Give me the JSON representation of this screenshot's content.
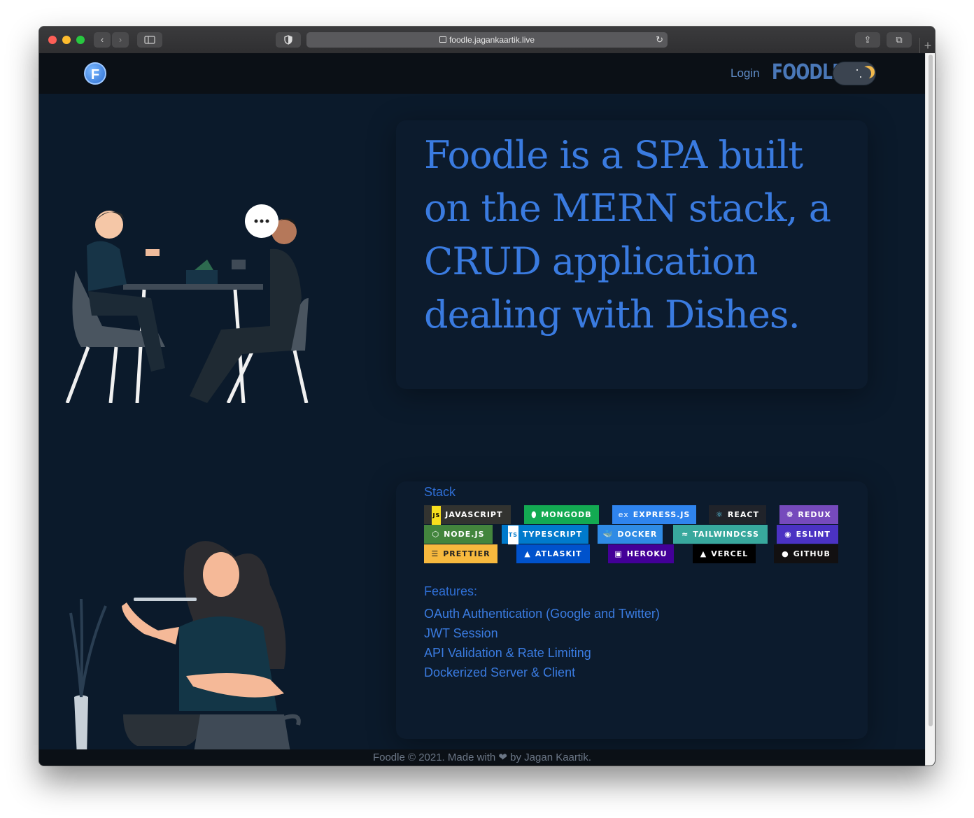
{
  "browser": {
    "url": "foodle.jagankaartik.live"
  },
  "nav": {
    "login": "Login",
    "brand": "FOODLE",
    "logo_letter": "F"
  },
  "hero": {
    "text": "Foodle is a SPA built on the MERN stack, a CRUD application dealing with Dishes."
  },
  "stack": {
    "title": "Stack",
    "badges": [
      {
        "label": "JAVASCRIPT",
        "icon": "js-icon",
        "color": "#323330"
      },
      {
        "label": "MONGODB",
        "icon": "leaf-icon",
        "color": "#13aa52"
      },
      {
        "label": "EXPRESS.JS",
        "icon": "express-icon",
        "color": "#2f84ee"
      },
      {
        "label": "REACT",
        "icon": "atom-icon",
        "color": "#20232a"
      },
      {
        "label": "REDUX",
        "icon": "redux-icon",
        "color": "#764abc"
      },
      {
        "label": "NODE.JS",
        "icon": "hexagon-icon",
        "color": "#43853d"
      },
      {
        "label": "TYPESCRIPT",
        "icon": "ts-icon",
        "color": "#007acc"
      },
      {
        "label": "DOCKER",
        "icon": "whale-icon",
        "color": "#2f8be5"
      },
      {
        "label": "TAILWINDCSS",
        "icon": "wave-icon",
        "color": "#38a89d"
      },
      {
        "label": "ESLINT",
        "icon": "eslint-icon",
        "color": "#4b32c3"
      },
      {
        "label": "PRETTIER",
        "icon": "prettier-icon",
        "color": "#f7b93e"
      },
      {
        "label": "ATLASKIT",
        "icon": "atlassian-icon",
        "color": "#0052cc"
      },
      {
        "label": "HEROKU",
        "icon": "heroku-icon",
        "color": "#430098"
      },
      {
        "label": "VERCEL",
        "icon": "triangle-icon",
        "color": "#000000"
      },
      {
        "label": "GITHUB",
        "icon": "github-icon",
        "color": "#121011"
      }
    ]
  },
  "features": {
    "title": "Features:",
    "items": [
      "OAuth Authentication (Google and Twitter)",
      "JWT Session",
      "API Validation & Rate Limiting",
      "Dockerized Server & Client"
    ]
  },
  "footer": {
    "text": "Foodle © 2021. Made with ❤ by Jagan Kaartik."
  }
}
